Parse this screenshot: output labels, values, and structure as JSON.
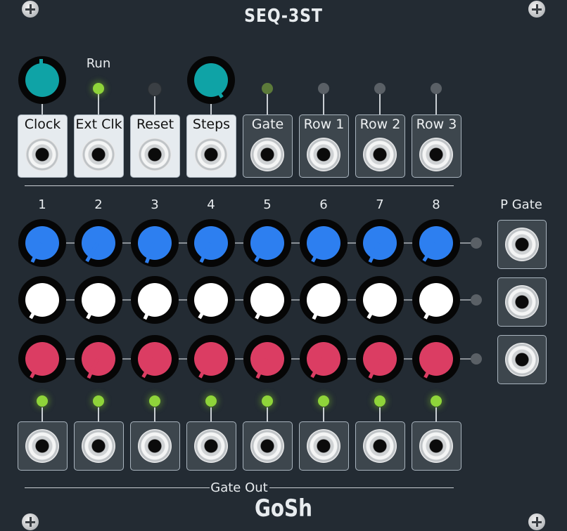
{
  "module": {
    "title": "SEQ-3ST",
    "brand": "GoSh"
  },
  "top": {
    "run_label": "Run",
    "inputs": [
      "Clock",
      "Ext Clk",
      "Reset",
      "Steps"
    ],
    "outputs": [
      "Gate",
      "Row 1",
      "Row 2",
      "Row 3"
    ]
  },
  "steps": {
    "labels": [
      "1",
      "2",
      "3",
      "4",
      "5",
      "6",
      "7",
      "8"
    ],
    "rows": [
      {
        "name": "row-1",
        "color": "#2d7ff0"
      },
      {
        "name": "row-2",
        "color": "#ffffff"
      },
      {
        "name": "row-3",
        "color": "#db3d63"
      }
    ],
    "p_gate_label": "P Gate",
    "gate_out_label": "Gate Out"
  },
  "colors": {
    "panel": "#232b33",
    "teal": "#0fa3a6",
    "led_green": "#8fd43a"
  }
}
